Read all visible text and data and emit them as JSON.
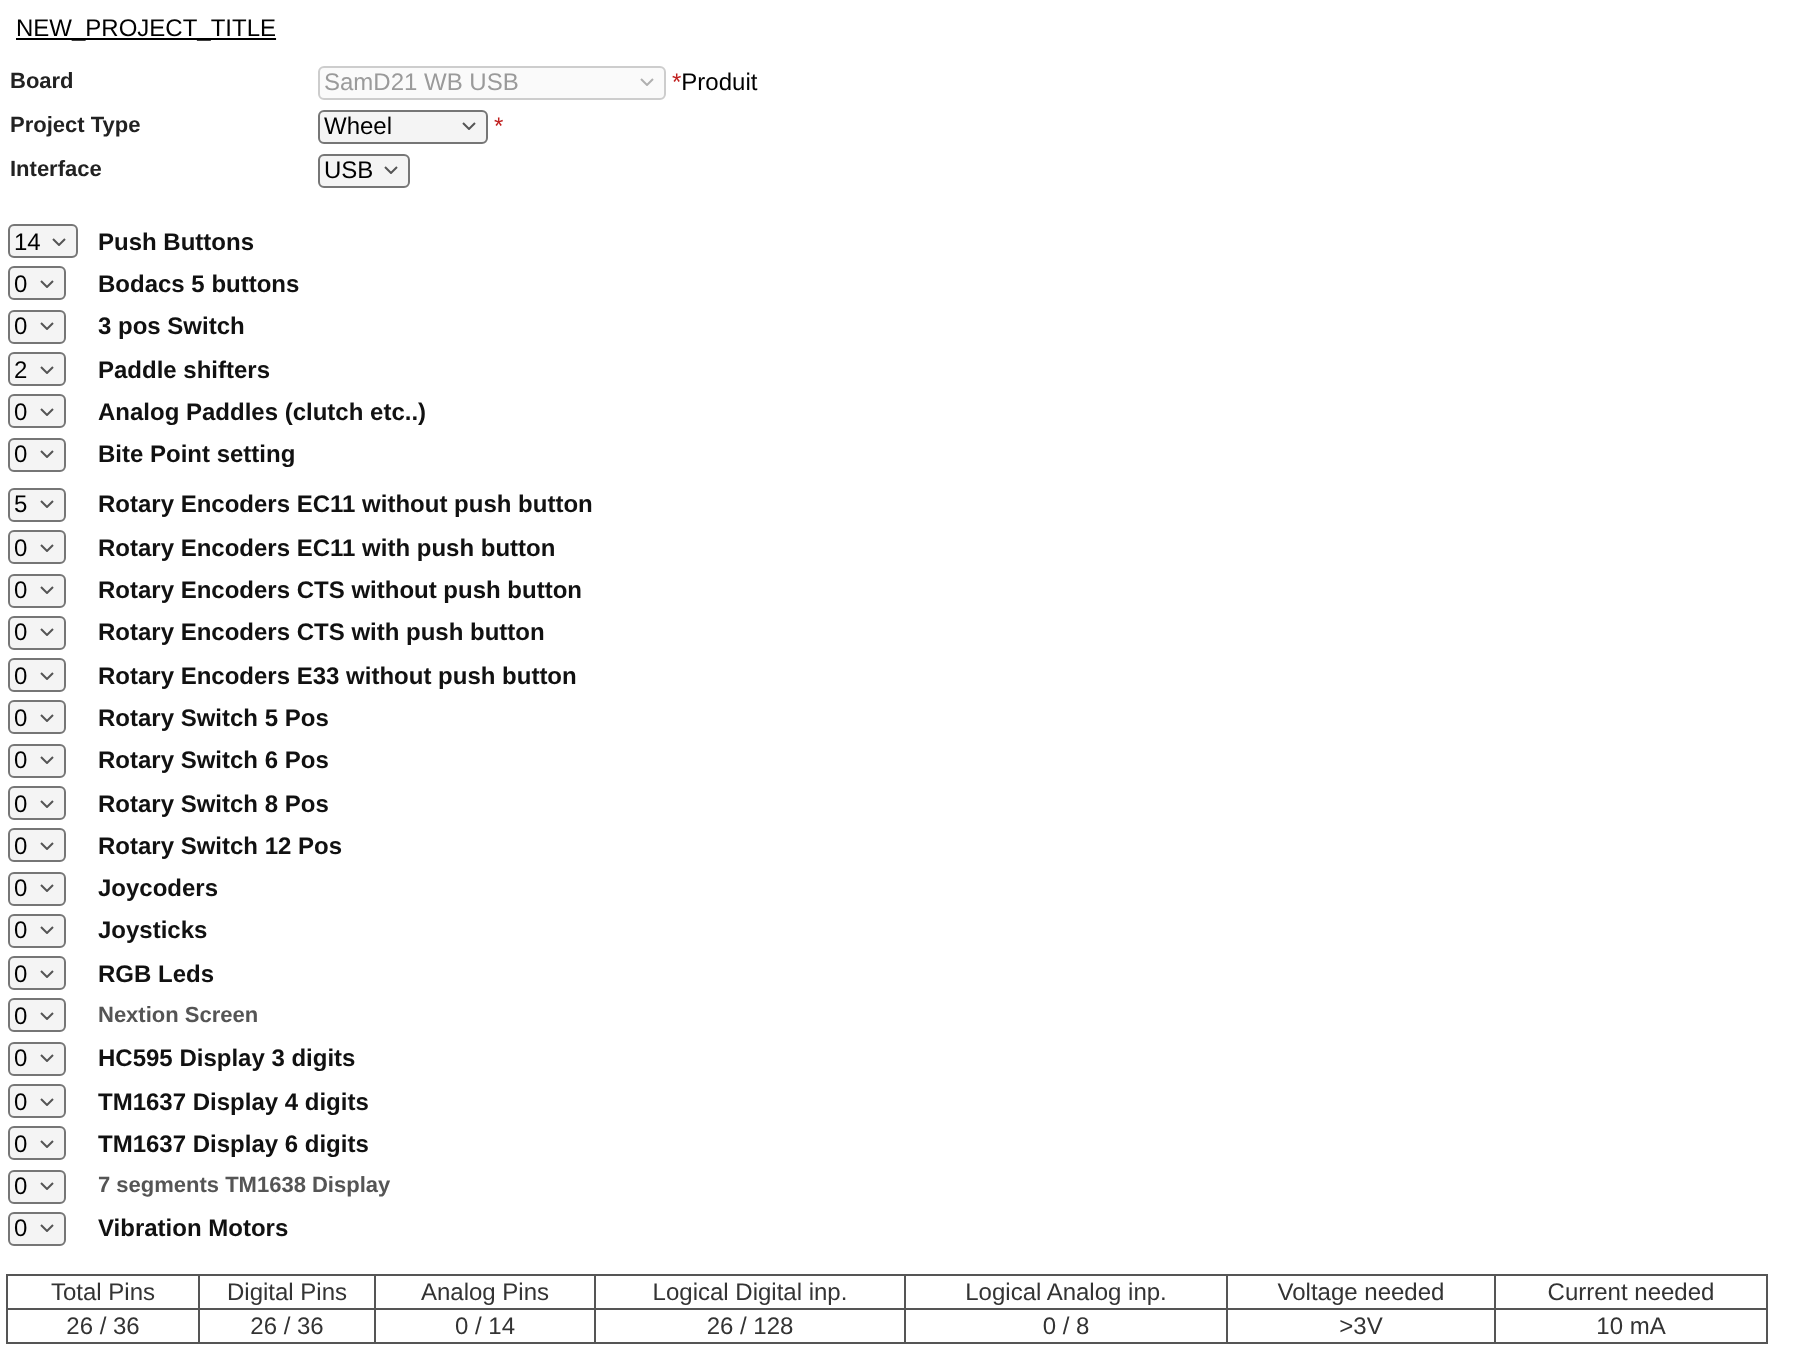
{
  "title": "NEW_PROJECT_TITLE",
  "settings": [
    {
      "label": "Board",
      "value": "SamD21 WB USB",
      "disabled": true,
      "required_mark": "*",
      "note": "Produit"
    },
    {
      "label": "Project Type",
      "value": "Wheel",
      "disabled": false,
      "required_mark": "*"
    },
    {
      "label": "Interface",
      "value": "USB",
      "disabled": false
    }
  ],
  "component_groups": [
    {
      "items": [
        {
          "count": "14",
          "label": "Push Buttons",
          "disabled": false
        },
        {
          "count": "0",
          "label": "Bodacs 5 buttons",
          "disabled": false
        },
        {
          "count": "0",
          "label": "3 pos Switch",
          "disabled": false
        },
        {
          "count": "2",
          "label": "Paddle shifters",
          "disabled": false
        },
        {
          "count": "0",
          "label": "Analog Paddles (clutch etc..)",
          "disabled": false
        },
        {
          "count": "0",
          "label": "Bite Point setting",
          "disabled": false
        }
      ]
    },
    {
      "items": [
        {
          "count": "5",
          "label": "Rotary Encoders EC11 without push button",
          "disabled": false
        },
        {
          "count": "0",
          "label": "Rotary Encoders EC11 with push button",
          "disabled": false
        },
        {
          "count": "0",
          "label": "Rotary Encoders CTS without push button",
          "disabled": false
        },
        {
          "count": "0",
          "label": "Rotary Encoders CTS with push button",
          "disabled": false
        },
        {
          "count": "0",
          "label": "Rotary Encoders E33 without push button",
          "disabled": false
        },
        {
          "count": "0",
          "label": "Rotary Switch 5 Pos",
          "disabled": false
        },
        {
          "count": "0",
          "label": "Rotary Switch 6 Pos",
          "disabled": false
        },
        {
          "count": "0",
          "label": "Rotary Switch 8 Pos",
          "disabled": false
        },
        {
          "count": "0",
          "label": "Rotary Switch 12 Pos",
          "disabled": false
        },
        {
          "count": "0",
          "label": "Joycoders",
          "disabled": false
        },
        {
          "count": "0",
          "label": "Joysticks",
          "disabled": false
        },
        {
          "count": "0",
          "label": "RGB Leds",
          "disabled": false
        },
        {
          "count": "0",
          "label": "Nextion Screen",
          "disabled": true
        },
        {
          "count": "0",
          "label": "HC595 Display 3 digits",
          "disabled": false
        },
        {
          "count": "0",
          "label": "TM1637 Display 4 digits",
          "disabled": false
        },
        {
          "count": "0",
          "label": "TM1637 Display 6 digits",
          "disabled": false
        },
        {
          "count": "0",
          "label": "7 segments TM1638 Display",
          "disabled": true
        },
        {
          "count": "0",
          "label": "Vibration Motors",
          "disabled": false
        }
      ]
    }
  ],
  "summary_table": {
    "columns": [
      "Total Pins",
      "Digital Pins",
      "Analog Pins",
      "Logical Digital inp.",
      "Logical Analog inp.",
      "Voltage needed",
      "Current needed"
    ],
    "rows": [
      [
        "26 / 36",
        "26 / 36",
        "0 / 14",
        "26 / 128",
        "0 / 8",
        ">3V",
        "10 mA"
      ]
    ]
  }
}
